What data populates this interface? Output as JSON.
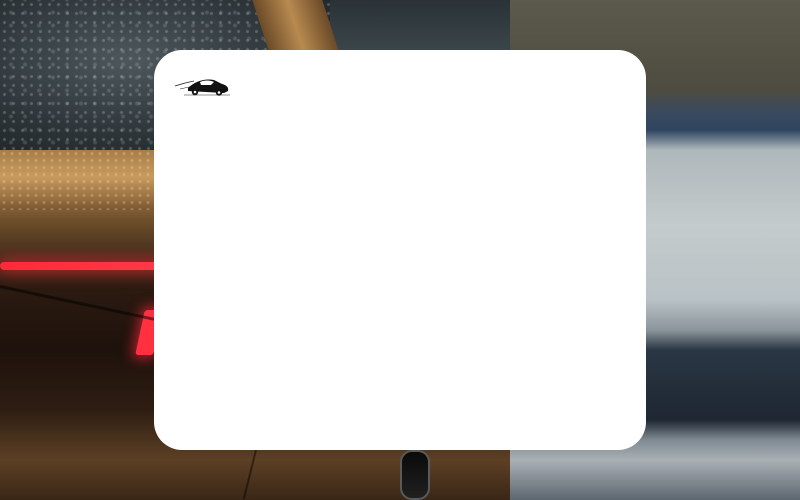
{
  "background": {
    "description_icon": "car-rear-photo",
    "taillight_color": "#ff2a38"
  },
  "card": {
    "background_color": "#ffffff",
    "logo_icon": "sports-car-silhouette-icon"
  }
}
